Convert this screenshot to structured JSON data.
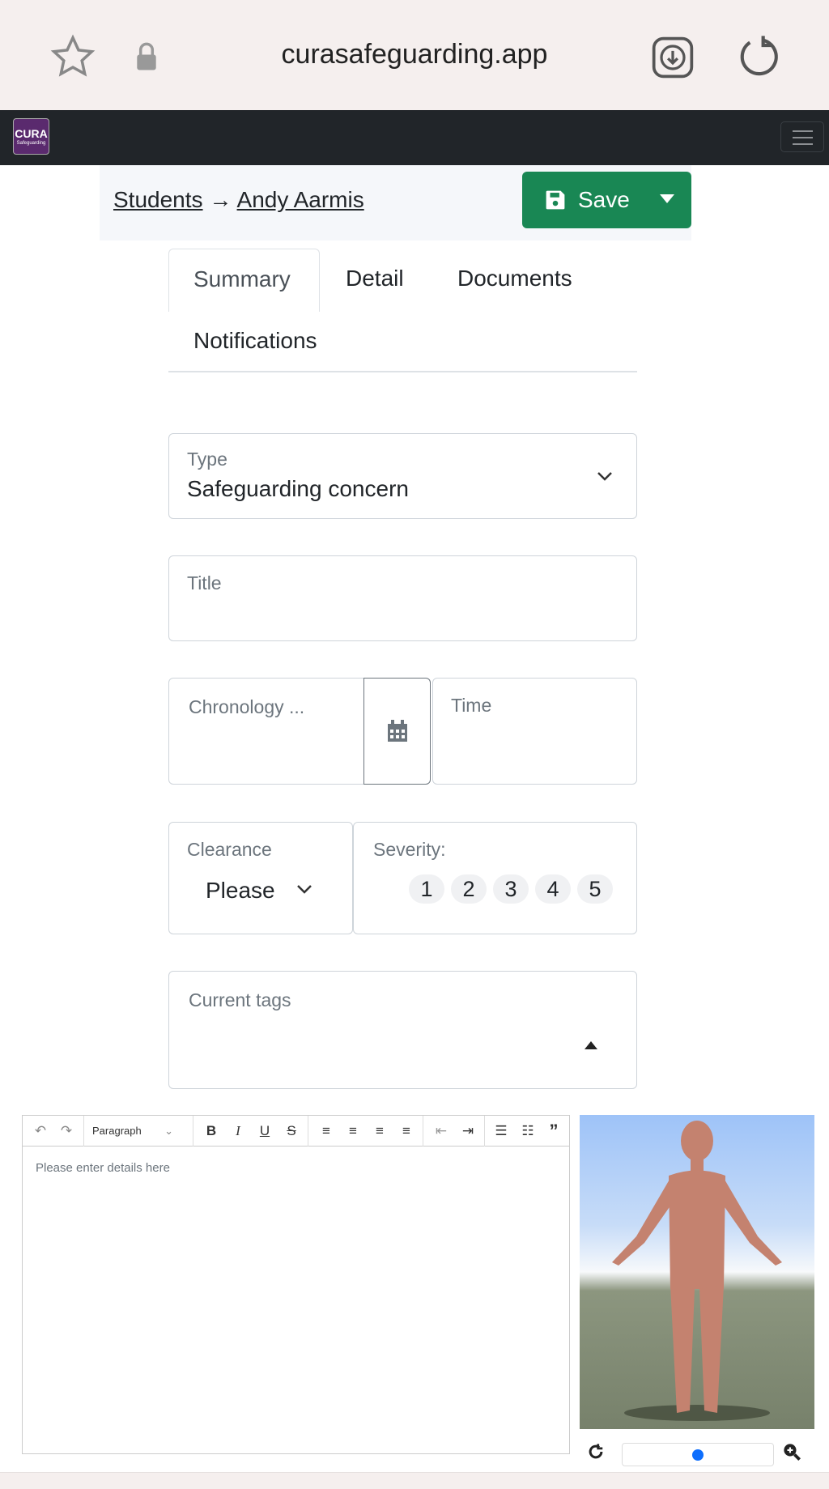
{
  "browser": {
    "url": "curasafeguarding.app",
    "icons": [
      "star-icon",
      "lock-icon",
      "download-icon",
      "reload-icon"
    ]
  },
  "navbar": {
    "logo_text": "CURA",
    "logo_sub": "Safeguarding"
  },
  "breadcrumb": {
    "students": "Students",
    "arrow": "→",
    "student": "Andy Aarmis"
  },
  "save": {
    "label": "Save",
    "color": "#198754"
  },
  "tabs": [
    {
      "label": "Summary",
      "active": true
    },
    {
      "label": "Detail"
    },
    {
      "label": "Documents"
    },
    {
      "label": "Notifications"
    }
  ],
  "form": {
    "type": {
      "label": "Type",
      "value": "Safeguarding concern"
    },
    "title": {
      "label": "Title",
      "value": ""
    },
    "chronology": {
      "label": "Chronology ..."
    },
    "time": {
      "label": "Time"
    },
    "clearance": {
      "label": "Clearance",
      "value": "Please"
    },
    "severity": {
      "label": "Severity:",
      "options": [
        "1",
        "2",
        "3",
        "4",
        "5"
      ]
    },
    "tags": {
      "label": "Current tags"
    }
  },
  "editor": {
    "format": "Paragraph",
    "placeholder": "Please enter details here",
    "tools": [
      "undo",
      "redo",
      "bold",
      "italic",
      "underline",
      "strikethrough",
      "align-left",
      "align-center",
      "align-right",
      "justify",
      "outdent",
      "indent",
      "numbered-list",
      "bullet-list",
      "blockquote"
    ]
  },
  "viewer": {
    "slider_value": 0.5
  }
}
